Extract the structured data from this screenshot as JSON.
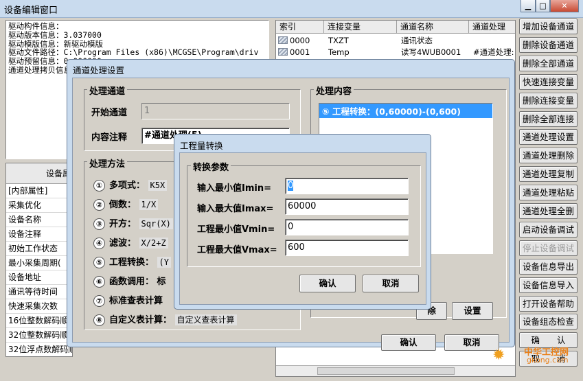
{
  "window": {
    "title": "设备编辑窗口",
    "min": "▁",
    "max": "□",
    "close": "✕"
  },
  "info_lines": [
    "驱动构件信息：",
    "驱动版本信息：3.037000",
    "驱动模版信息：新驱动模版",
    "驱动文件路径：C:\\Program Files (x86)\\MCGSE\\Program\\driv",
    "驱动预留信息：0.000000",
    "通道处理拷贝信息：无"
  ],
  "props": {
    "header": "设备属",
    "rows": [
      "[内部属性]",
      "采集优化",
      "设备名称",
      "设备注释",
      "初始工作状态",
      "最小采集周期(",
      "设备地址",
      "通讯等待时间",
      "快速采集次数",
      "16位整数解码顺",
      "32位整数解码顺",
      "32位浮点数解码顺"
    ]
  },
  "channel_table": {
    "headers": [
      "索引",
      "连接变量",
      "通道名称",
      "通道处理"
    ],
    "rows": [
      [
        "0000",
        "TXZT",
        "通讯状态",
        ""
      ],
      [
        "0001",
        "Temp",
        "读写4WUB0001",
        "#通道处理:"
      ]
    ]
  },
  "right_buttons": [
    {
      "label": "增加设备通道",
      "disabled": false
    },
    {
      "label": "删除设备通道",
      "disabled": false
    },
    {
      "label": "删除全部通道",
      "disabled": false
    },
    {
      "label": "快速连接变量",
      "disabled": false
    },
    {
      "label": "删除连接变量",
      "disabled": false
    },
    {
      "label": "删除全部连接",
      "disabled": false
    },
    {
      "label": "通道处理设置",
      "disabled": false
    },
    {
      "label": "通道处理删除",
      "disabled": false
    },
    {
      "label": "通道处理复制",
      "disabled": false
    },
    {
      "label": "通道处理粘贴",
      "disabled": false
    },
    {
      "label": "通道处理全删",
      "disabled": false
    },
    {
      "label": "启动设备调试",
      "disabled": false
    },
    {
      "label": "停止设备调试",
      "disabled": true
    },
    {
      "label": "设备信息导出",
      "disabled": false
    },
    {
      "label": "设备信息导入",
      "disabled": false
    },
    {
      "label": "打开设备帮助",
      "disabled": false
    },
    {
      "label": "设备组态检查",
      "disabled": false
    },
    {
      "label": "确　　认",
      "disabled": false
    },
    {
      "label": "取　　消",
      "disabled": false
    }
  ],
  "dlg_process": {
    "title": "通道处理设置",
    "group_channel": "处理通道",
    "start_label": "开始通道",
    "start_value": "1",
    "note_label": "内容注释",
    "note_value": "#通道处理(5)",
    "group_method": "处理方法",
    "methods": [
      {
        "num": "①",
        "label": "多项式：",
        "value": "K5X"
      },
      {
        "num": "②",
        "label": "倒数：",
        "value": "1/X"
      },
      {
        "num": "③",
        "label": "开方：",
        "value": "Sqr(X)"
      },
      {
        "num": "④",
        "label": "滤波：",
        "value": "X/2+Z"
      },
      {
        "num": "⑤",
        "label": "工程转换：",
        "value": "(Y"
      },
      {
        "num": "⑥",
        "label": "函数调用：",
        "value": "标"
      },
      {
        "num": "⑦",
        "label": "标准查表计算",
        "value": ""
      },
      {
        "num": "⑧",
        "label": "自定义表计算：",
        "value": "自定义查表计算"
      }
    ],
    "group_content": "处理内容",
    "content_item": "⑤ 工程转换：(0,60000)-(0,600)",
    "btn_delete": "除",
    "btn_settings": "设置",
    "btn_ok": "确认",
    "btn_cancel": "取消"
  },
  "dlg_convert": {
    "title": "工程量转换",
    "group": "转换参数",
    "fields": [
      {
        "label": "输入最小值Imin=",
        "value": "0"
      },
      {
        "label": "输入最大值Imax=",
        "value": "60000"
      },
      {
        "label": "工程最小值Vmin=",
        "value": "0"
      },
      {
        "label": "工程最大值Vmax=",
        "value": "600"
      }
    ],
    "btn_ok": "确认",
    "btn_cancel": "取消"
  },
  "watermark": {
    "cn": "中华工控网",
    "url": "gkong.com"
  }
}
